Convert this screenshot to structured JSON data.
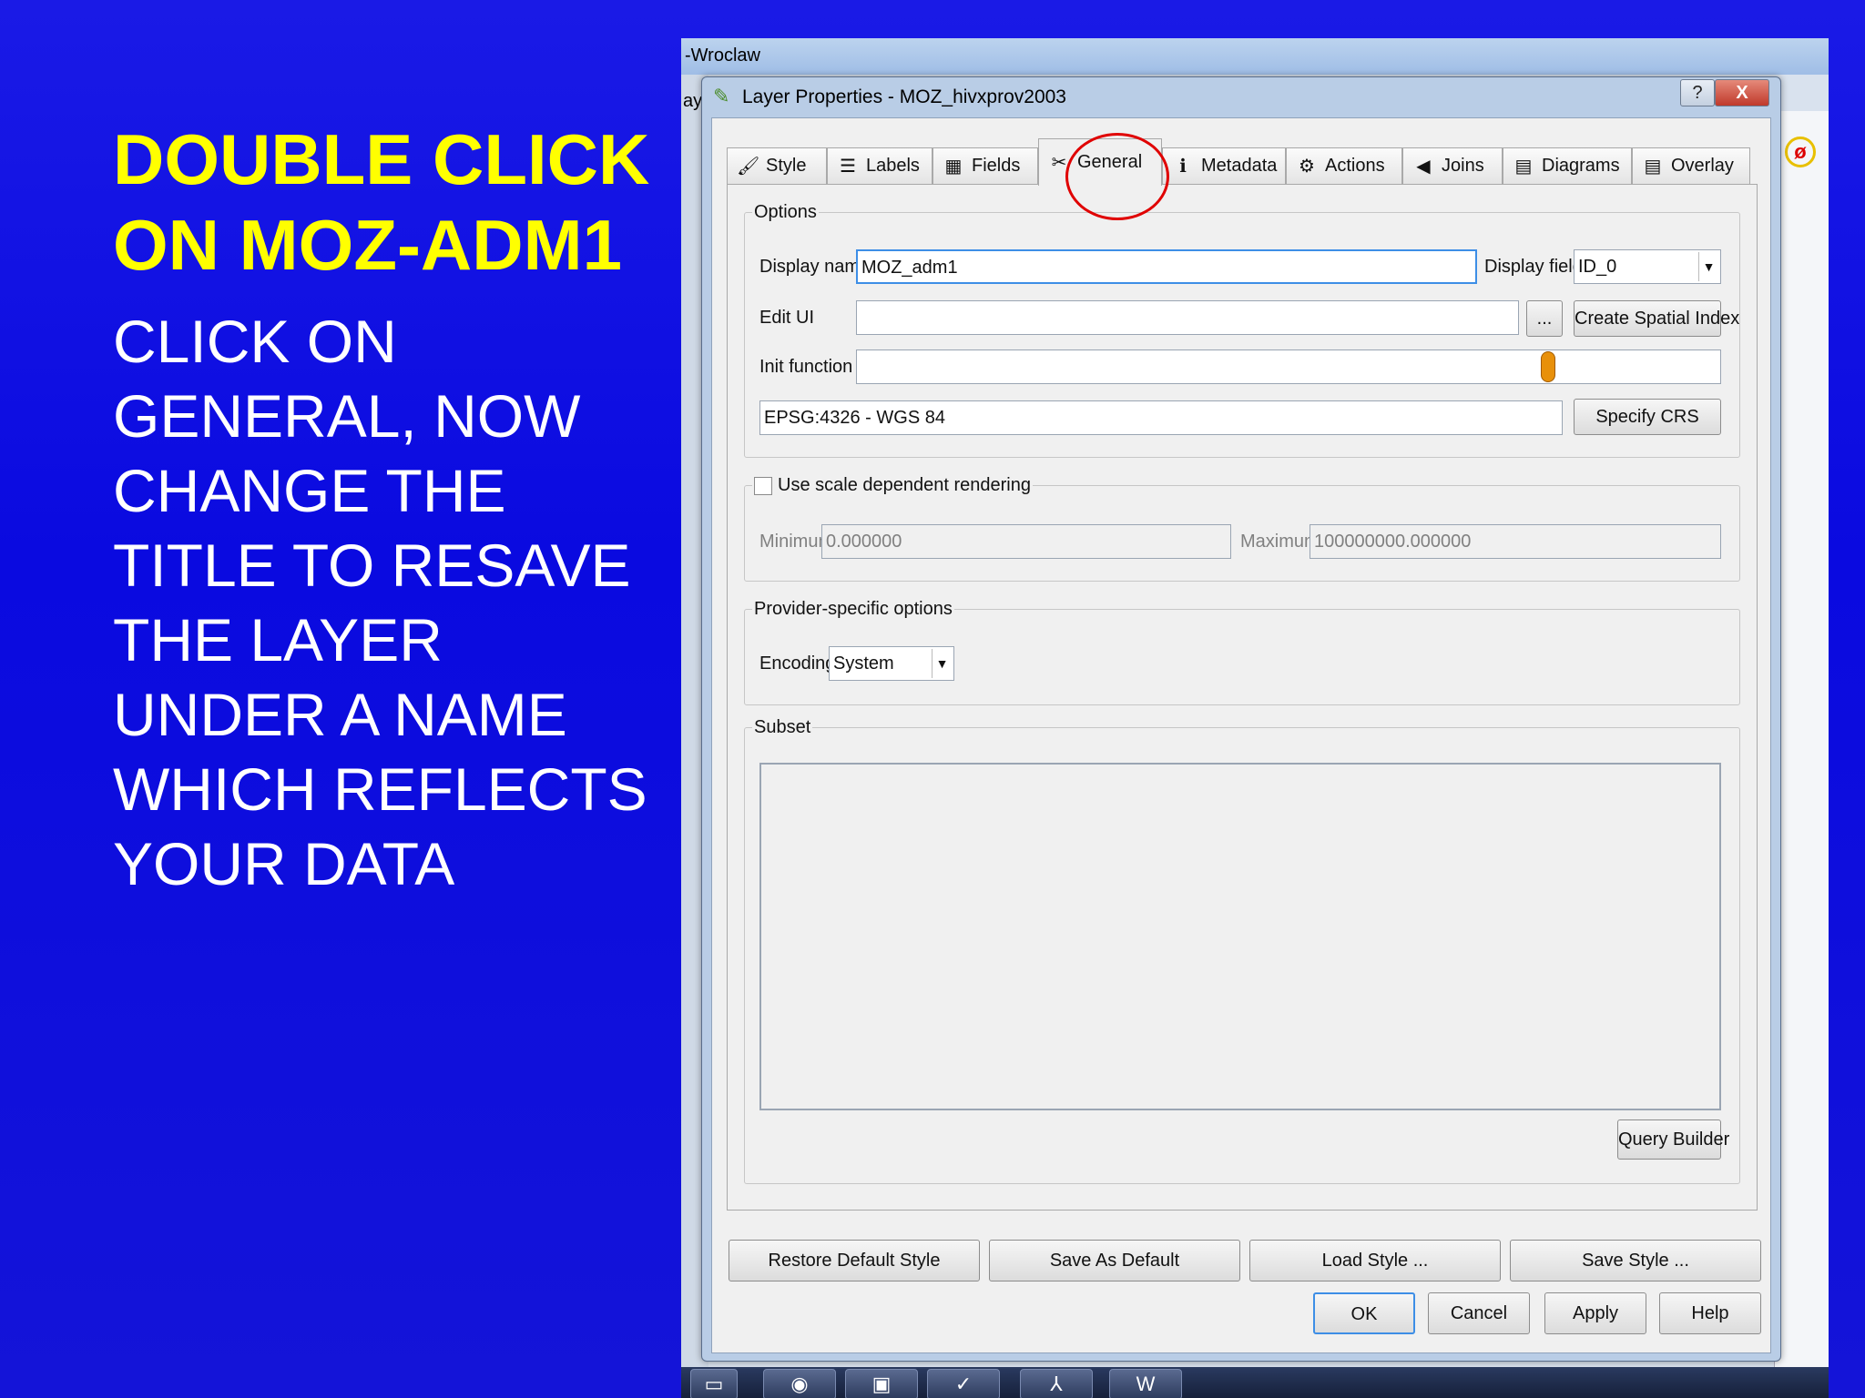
{
  "slide": {
    "title_lines": [
      "DOUBLE CLICK",
      "ON MOZ-ADM1"
    ],
    "body_lines": [
      "CLICK ON",
      "GENERAL, NOW",
      "CHANGE THE",
      "TITLE TO RESAVE",
      "THE LAYER",
      "UNDER A NAME",
      "WHICH REFLECTS",
      "YOUR DATA"
    ]
  },
  "background_window": {
    "title": "-Wroclaw",
    "left_label": "ay"
  },
  "dialog": {
    "title": "Layer Properties - MOZ_hivxprov2003",
    "help_label": "?",
    "close_label": "X"
  },
  "tabs": [
    {
      "label": "Style",
      "icon": "style-icon",
      "glyph": "🖌"
    },
    {
      "label": "Labels",
      "icon": "labels-icon",
      "glyph": "☰"
    },
    {
      "label": "Fields",
      "icon": "fields-icon",
      "glyph": "▦"
    },
    {
      "label": "General",
      "icon": "general-icon",
      "glyph": "✂",
      "active": true
    },
    {
      "label": "Metadata",
      "icon": "metadata-icon",
      "glyph": "ℹ"
    },
    {
      "label": "Actions",
      "icon": "actions-icon",
      "glyph": "⚙"
    },
    {
      "label": "Joins",
      "icon": "joins-icon",
      "glyph": "◀"
    },
    {
      "label": "Diagrams",
      "icon": "diagrams-icon",
      "glyph": "▤"
    },
    {
      "label": "Overlay",
      "icon": "overlay-icon",
      "glyph": "▤"
    }
  ],
  "options": {
    "group_title": "Options",
    "display_name_label": "Display name",
    "display_name_value": "MOZ_adm1",
    "display_field_label": "Display field",
    "display_field_value": "ID_0",
    "edit_ui_label": "Edit UI",
    "edit_ui_value": "",
    "browse_label": "...",
    "create_spatial_index_label": "Create Spatial Index",
    "init_function_label": "Init function",
    "init_function_value": "",
    "crs_value": "EPSG:4326 - WGS 84",
    "specify_crs_label": "Specify CRS"
  },
  "scale": {
    "checkbox_label": "Use scale dependent rendering",
    "checked": false,
    "minimum_label": "Minimum",
    "minimum_value": "0.000000",
    "maximum_label": "Maximum",
    "maximum_value": "100000000.000000"
  },
  "provider": {
    "group_title": "Provider-specific options",
    "encoding_label": "Encoding",
    "encoding_value": "System"
  },
  "subset": {
    "group_title": "Subset",
    "query_builder_label": "Query Builder"
  },
  "style_buttons": {
    "restore_default": "Restore Default Style",
    "save_as_default": "Save As Default",
    "load_style": "Load Style ...",
    "save_style": "Save Style ..."
  },
  "dialog_buttons": {
    "ok": "OK",
    "cancel": "Cancel",
    "apply": "Apply",
    "help": "Help"
  },
  "colors": {
    "slide_title": "#ffff00",
    "slide_body": "#ffffff",
    "slide_background": "#0a0ae0",
    "highlight_circle": "#e00000"
  }
}
